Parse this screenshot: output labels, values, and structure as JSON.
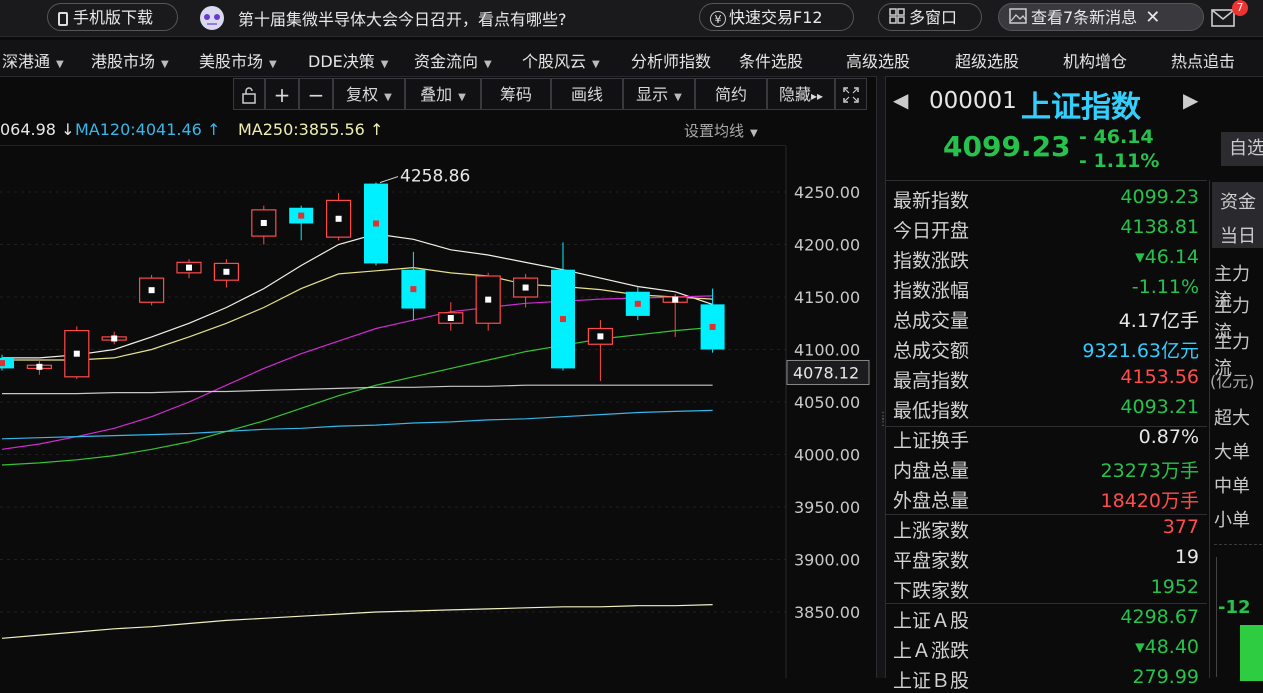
{
  "topbar": {
    "mobile_download": "手机版下载",
    "news_text": "第十届集微半导体大会今日召开，看点有哪些?",
    "quick_trade": "快速交易F12",
    "multi_window": "多窗口",
    "new_messages": "查看7条新消息",
    "mail_badge": "7"
  },
  "menu": {
    "items": [
      "深港通",
      "港股市场",
      "美股市场",
      "DDE决策",
      "资金流向",
      "个股风云",
      "分析师指数",
      "条件选股",
      "高级选股",
      "超级选股",
      "机构增仓",
      "热点追击"
    ]
  },
  "toolbar": {
    "plus": "+",
    "minus": "−",
    "fuquan": "复权",
    "overlay": "叠加",
    "chips": "筹码",
    "draw": "画线",
    "display": "显示",
    "simple": "简约",
    "hide": "隐藏"
  },
  "ma": {
    "ma60": "064.98",
    "ma120": "MA120:4041.46",
    "ma250": "MA250:3855.56",
    "settings": "设置均线"
  },
  "chart_data": {
    "type": "candlestick",
    "yticks": [
      "4250.00",
      "4200.00",
      "4150.00",
      "4100.00",
      "4050.00",
      "4000.00",
      "3950.00",
      "3900.00",
      "3850.00"
    ],
    "ylim": [
      3825,
      4275
    ],
    "current_price_label": "4078.12",
    "high_annotation": "4258.86",
    "candles": [
      {
        "o": 4092,
        "c": 4082,
        "h": 4095,
        "l": 4080
      },
      {
        "o": 4082,
        "c": 4085,
        "h": 4092,
        "l": 4076
      },
      {
        "o": 4074,
        "c": 4118,
        "h": 4122,
        "l": 4072
      },
      {
        "o": 4109,
        "c": 4112,
        "h": 4117,
        "l": 4105
      },
      {
        "o": 4145,
        "c": 4168,
        "h": 4171,
        "l": 4142
      },
      {
        "o": 4173,
        "c": 4183,
        "h": 4186,
        "l": 4168
      },
      {
        "o": 4166,
        "c": 4182,
        "h": 4186,
        "l": 4159
      },
      {
        "o": 4208,
        "c": 4233,
        "h": 4237,
        "l": 4200
      },
      {
        "o": 4235,
        "c": 4220,
        "h": 4237,
        "l": 4204
      },
      {
        "o": 4207,
        "c": 4242,
        "h": 4249,
        "l": 4204
      },
      {
        "o": 4258,
        "c": 4182,
        "h": 4259,
        "l": 4180
      },
      {
        "o": 4176,
        "c": 4139,
        "h": 4193,
        "l": 4128
      },
      {
        "o": 4125,
        "c": 4135,
        "h": 4145,
        "l": 4118
      },
      {
        "o": 4125,
        "c": 4170,
        "h": 4173,
        "l": 4118
      },
      {
        "o": 4150,
        "c": 4168,
        "h": 4172,
        "l": 4140
      },
      {
        "o": 4176,
        "c": 4082,
        "h": 4202,
        "l": 4080
      },
      {
        "o": 4105,
        "c": 4120,
        "h": 4128,
        "l": 4070
      },
      {
        "o": 4155,
        "c": 4132,
        "h": 4160,
        "l": 4128
      },
      {
        "o": 4145,
        "c": 4150,
        "h": 4153,
        "l": 4112
      },
      {
        "o": 4143,
        "c": 4100,
        "h": 4158,
        "l": 4097
      }
    ],
    "ma_lines": [
      {
        "color": "#f2f2e6",
        "values": [
          4092,
          4092,
          4095,
          4100,
          4112,
          4125,
          4140,
          4158,
          4180,
          4200,
          4210,
          4205,
          4195,
          4190,
          4183,
          4176,
          4168,
          4160,
          4155,
          4143
        ]
      },
      {
        "color": "#e6e08a",
        "values": [
          4090,
          4090,
          4090,
          4092,
          4100,
          4112,
          4125,
          4140,
          4158,
          4172,
          4175,
          4178,
          4173,
          4170,
          4162,
          4160,
          4157,
          4152,
          4150,
          4148
        ]
      },
      {
        "color": "#d02cd0",
        "values": [
          4005,
          4010,
          4017,
          4025,
          4036,
          4050,
          4066,
          4082,
          4096,
          4108,
          4120,
          4128,
          4136,
          4140,
          4144,
          4146,
          4148,
          4149,
          4150,
          4151
        ]
      },
      {
        "color": "#34c434",
        "values": [
          3990,
          3992,
          3995,
          3999,
          4005,
          4012,
          4022,
          4032,
          4044,
          4056,
          4066,
          4074,
          4082,
          4090,
          4098,
          4104,
          4110,
          4114,
          4118,
          4121
        ]
      },
      {
        "color": "#37b6ea",
        "values": [
          4015,
          4016,
          4017,
          4018,
          4019,
          4020,
          4022,
          4024,
          4025,
          4027,
          4028,
          4030,
          4031,
          4033,
          4034,
          4036,
          4038,
          4040,
          4041,
          4042
        ]
      },
      {
        "color": "#c8c8c8",
        "values": [
          4058,
          4058,
          4058,
          4059,
          4059,
          4060,
          4060,
          4061,
          4062,
          4063,
          4064,
          4064,
          4065,
          4065,
          4066,
          4066,
          4066,
          4066,
          4066,
          4066
        ]
      },
      {
        "color": "#f0f0c0",
        "values": [
          3825,
          3828,
          3831,
          3834,
          3836,
          3839,
          3842,
          3844,
          3846,
          3848,
          3850,
          3851,
          3852,
          3853,
          3854,
          3855,
          3855,
          3856,
          3856,
          3857
        ]
      }
    ]
  },
  "quote": {
    "code": "000001",
    "name": "上证指数",
    "price": "4099.23",
    "change": "- 46.14",
    "change_pct": "- 1.11%",
    "self_select": "自选"
  },
  "stats": [
    {
      "label": "最新指数",
      "value": "4099.23",
      "color": "green"
    },
    {
      "label": "今日开盘",
      "value": "4138.81",
      "color": "green"
    },
    {
      "label": "指数涨跌",
      "value": "▾46.14",
      "color": "green"
    },
    {
      "label": "指数涨幅",
      "value": "-1.11%",
      "color": "green"
    },
    {
      "label": "总成交量",
      "value": "4.17亿手",
      "color": "white"
    },
    {
      "label": "总成交额",
      "value": "9321.63亿元",
      "color": "cyan"
    },
    {
      "label": "最高指数",
      "value": "4153.56",
      "color": "red"
    },
    {
      "label": "最低指数",
      "value": "4093.21",
      "color": "green"
    },
    {
      "label": "上证换手",
      "value": "0.87%",
      "color": "white"
    },
    {
      "label": "内盘总量",
      "value": "23273万手",
      "color": "green"
    },
    {
      "label": "外盘总量",
      "value": "18420万手",
      "color": "red"
    },
    {
      "label": "上涨家数",
      "value": "377",
      "color": "red"
    },
    {
      "label": "平盘家数",
      "value": "19",
      "color": "white"
    },
    {
      "label": "下跌家数",
      "value": "1952",
      "color": "green"
    },
    {
      "label": "上证Ａ股",
      "value": "4298.67",
      "color": "green"
    },
    {
      "label": "上Ａ涨跌",
      "value": "▾48.40",
      "color": "green"
    },
    {
      "label": "上证Ｂ股",
      "value": "279.99",
      "color": "green"
    }
  ],
  "side": {
    "tab1": "资金",
    "tab2": "当日",
    "main1": "主力流",
    "main2": "主力流",
    "main3": "主力流",
    "unit": "(亿元)",
    "big1": "超大",
    "big2": "大单",
    "big3": "中单",
    "big4": "小单",
    "bar_value": "-12"
  }
}
